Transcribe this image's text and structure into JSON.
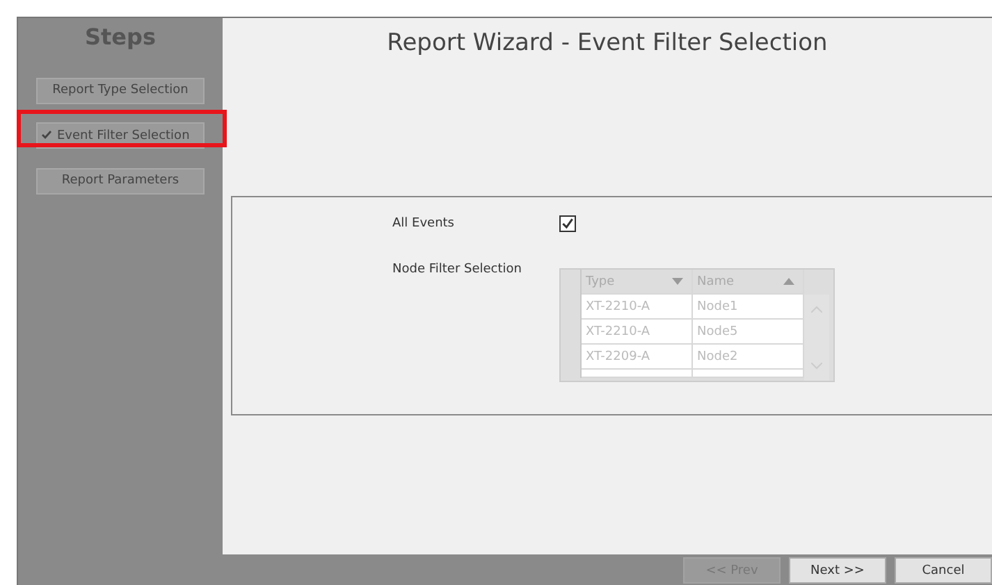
{
  "sidebar": {
    "title": "Steps",
    "steps": [
      {
        "label": "Report Type Selection",
        "selected": false
      },
      {
        "label": "Event Filter Selection",
        "selected": true
      },
      {
        "label": "Report Parameters",
        "selected": false
      }
    ]
  },
  "title": "Report Wizard - Event Filter Selection",
  "filter": {
    "all_events": {
      "label": "All Events",
      "checked": true
    },
    "node_filter": {
      "label": "Node Filter Selection",
      "columns": [
        {
          "label": "Type",
          "sort_ascending": false
        },
        {
          "label": "Name",
          "sort_ascending": true
        }
      ],
      "rows": [
        [
          "XT-2210-A",
          "Node1"
        ],
        [
          "XT-2210-A",
          "Node5"
        ],
        [
          "XT-2209-A",
          "Node2"
        ]
      ]
    }
  },
  "buttons": [
    {
      "label": "<< Prev",
      "disabled": true
    },
    {
      "label": "Next >>",
      "disabled": false
    },
    {
      "label": "Cancel",
      "disabled": false
    }
  ]
}
